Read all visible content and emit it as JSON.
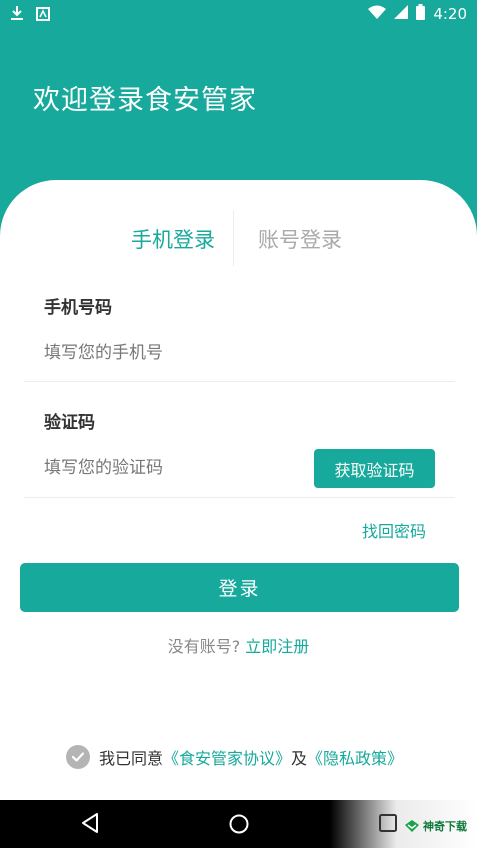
{
  "status_bar": {
    "time": "4:20",
    "icons": [
      "download-icon",
      "app-notification-icon",
      "wifi-icon",
      "signal-icon",
      "battery-icon"
    ]
  },
  "header": {
    "welcome": "欢迎登录食安管家"
  },
  "tabs": [
    {
      "label": "手机登录",
      "active": true
    },
    {
      "label": "账号登录",
      "active": false
    }
  ],
  "form": {
    "phone": {
      "label": "手机号码",
      "placeholder": "填写您的手机号",
      "value": ""
    },
    "code": {
      "label": "验证码",
      "placeholder": "填写您的验证码",
      "value": "",
      "button": "获取验证码"
    },
    "forgot": "找回密码"
  },
  "login_button": "登录",
  "register": {
    "prompt": "没有账号?",
    "link": "立即注册"
  },
  "agreement": {
    "prefix": "我已同意",
    "terms": "《食安管家协议》",
    "and": "及",
    "privacy": "《隐私政策》",
    "checked": false
  },
  "watermark": {
    "text": "神奇下载"
  },
  "colors": {
    "accent": "#17a99b",
    "checkbox": "#b4b4b4",
    "navbar": "#000000"
  }
}
